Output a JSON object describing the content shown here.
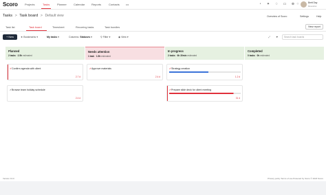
{
  "topnav": {
    "logo": "Scoro",
    "items": [
      "Projects",
      "Tasks",
      "Planner",
      "Calendar",
      "Reports",
      "Contacts",
      "•••"
    ],
    "active_item": "Tasks",
    "icons": [
      "timer-icon",
      "bulb-icon",
      "bell-icon",
      "chat-icon",
      "add-icon",
      "grid-icon"
    ],
    "user": {
      "name": "Brett Day",
      "company": "Moonshot"
    }
  },
  "breadcrumb": {
    "root": "Tasks",
    "separator": ">",
    "page": "Task board",
    "view": "Default view"
  },
  "page_actions": {
    "overview": "Overview of Scoro",
    "settings": "Settings",
    "help": "Help"
  },
  "tabs": {
    "items": [
      "Task list",
      "Task board",
      "Timesheet",
      "Recurring tasks",
      "Task bundles"
    ],
    "active": "Task board",
    "new_report": "New report"
  },
  "toolbar": {
    "new_label": "+ New",
    "bookmarks": "Bookmarks",
    "my_tasks": "My tasks",
    "columns_label": "Columns:",
    "columns_value": "Statuses",
    "filter": "Filter",
    "view": "View",
    "search_placeholder": "Search task boards"
  },
  "columns": [
    {
      "title": "Planned",
      "tasks": "2 tasks",
      "hours": "2.5h",
      "hours_label": "estimated",
      "color": "#e6f1e1",
      "cards": [
        {
          "title": "Confirm agenda with client",
          "meta": "2.7 d"
        },
        {
          "title": "Browse team holiday schedule",
          "meta": "2.4 d"
        }
      ]
    },
    {
      "title": "Needs attention",
      "tasks": "1 task",
      "hours": "1.5h",
      "hours_label": "estimated",
      "color": "#f8dfe2",
      "cards": [
        {
          "title": "Approve materials",
          "meta": "2.4 d"
        }
      ]
    },
    {
      "title": "In progress",
      "tasks": "2 tasks",
      "hours": "6h 30min",
      "hours_label": "estimated",
      "color": "#e6f1e1",
      "cards": [
        {
          "title": "Strategy creation",
          "meta": "1.2 d",
          "progress": 0.55,
          "progress_color": "#3a72d8"
        },
        {
          "title": "Prepare slide deck for client meeting",
          "meta": "31 d",
          "progress": 0.9,
          "progress_color": "#e0303a"
        }
      ]
    },
    {
      "title": "Completed",
      "tasks": "0 tasks",
      "hours": "0h",
      "hours_label": "estimated",
      "color": "#e6f1e1",
      "cards": []
    }
  ],
  "footer": {
    "version": "Version 13.0",
    "links": "Privacy policy  Terms of use  Powered by Scoro © 2023 Scoro"
  }
}
